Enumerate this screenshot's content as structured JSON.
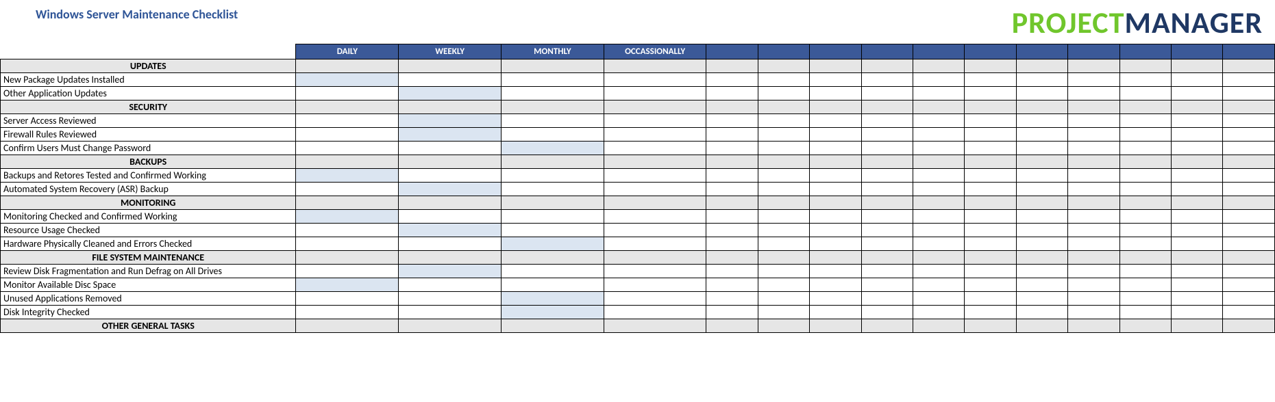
{
  "title": "Windows Server Maintenance Checklist",
  "logo": {
    "word1": "PROJECT",
    "word2": "MANAGER"
  },
  "columns": {
    "freq": [
      "DAILY",
      "WEEKLY",
      "MONTHLY",
      "OCCASSIONALLY"
    ],
    "blank_count": 11
  },
  "rows": [
    {
      "type": "section",
      "label": "UPDATES"
    },
    {
      "type": "item",
      "label": "New Package Updates Installed",
      "marks": [
        0
      ]
    },
    {
      "type": "item",
      "label": "Other Application Updates",
      "marks": [
        1
      ]
    },
    {
      "type": "section",
      "label": "SECURITY"
    },
    {
      "type": "item",
      "label": "Server Access Reviewed",
      "marks": [
        1
      ]
    },
    {
      "type": "item",
      "label": "Firewall Rules Reviewed",
      "marks": [
        1
      ]
    },
    {
      "type": "item",
      "label": "Confirm Users Must Change Password",
      "marks": [
        2
      ]
    },
    {
      "type": "section",
      "label": "BACKUPS"
    },
    {
      "type": "item",
      "label": "Backups and Retores Tested and Confirmed Working",
      "marks": [
        0
      ]
    },
    {
      "type": "item",
      "label": "Automated System Recovery (ASR) Backup",
      "marks": [
        1
      ]
    },
    {
      "type": "section",
      "label": "MONITORING"
    },
    {
      "type": "item",
      "label": "Monitoring Checked and Confirmed Working",
      "marks": [
        0
      ]
    },
    {
      "type": "item",
      "label": "Resource Usage Checked",
      "marks": [
        1
      ]
    },
    {
      "type": "item",
      "label": "Hardware Physically Cleaned and Errors Checked",
      "marks": [
        2
      ]
    },
    {
      "type": "section",
      "label": "FILE SYSTEM MAINTENANCE"
    },
    {
      "type": "item",
      "label": "Review Disk Fragmentation and Run Defrag on All Drives",
      "marks": [
        1
      ]
    },
    {
      "type": "item",
      "label": "Monitor Available Disc Space",
      "marks": [
        0
      ]
    },
    {
      "type": "item",
      "label": "Unused Applications Removed",
      "marks": [
        2
      ]
    },
    {
      "type": "item",
      "label": "Disk Integrity Checked",
      "marks": [
        2
      ]
    },
    {
      "type": "section",
      "label": "OTHER GENERAL TASKS"
    }
  ]
}
